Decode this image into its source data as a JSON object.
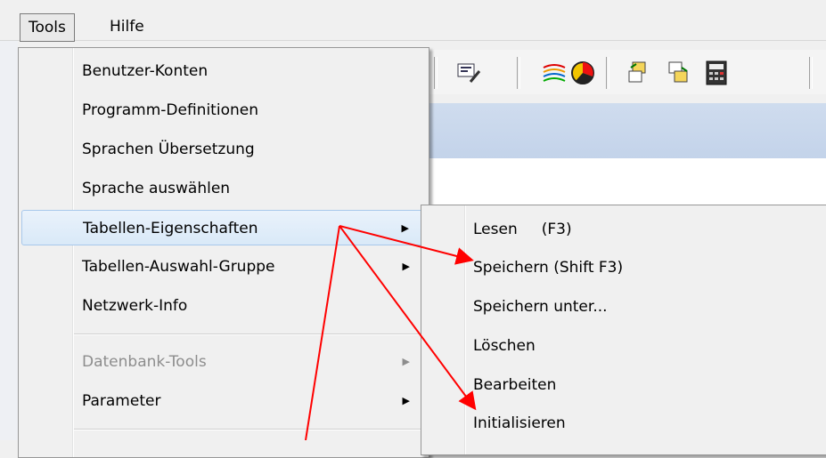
{
  "menubar": {
    "tools": "Tools",
    "hilfe": "Hilfe"
  },
  "tools_menu": {
    "items": [
      {
        "label": "Benutzer-Konten"
      },
      {
        "label": "Programm-Definitionen"
      },
      {
        "label": "Sprachen Übersetzung"
      },
      {
        "label": "Sprache auswählen"
      },
      {
        "label": "Tabellen-Eigenschaften"
      },
      {
        "label": "Tabellen-Auswahl-Gruppe"
      },
      {
        "label": "Netzwerk-Info"
      },
      {
        "label": "Datenbank-Tools"
      },
      {
        "label": "Parameter"
      }
    ]
  },
  "submenu": {
    "items": [
      {
        "label": "Lesen     (F3)"
      },
      {
        "label": "Speichern (Shift F3)"
      },
      {
        "label": "Speichern unter..."
      },
      {
        "label": "Löschen"
      },
      {
        "label": "Bearbeiten"
      },
      {
        "label": "Initialisieren"
      }
    ]
  },
  "colors": {
    "annotation_arrow": "#ff0000",
    "highlight": "#d9e9f8"
  }
}
